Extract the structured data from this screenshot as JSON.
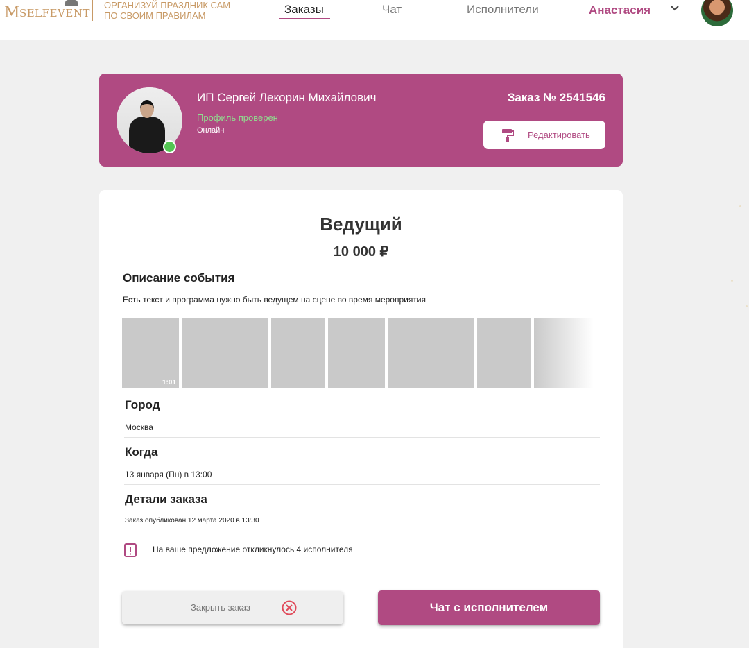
{
  "header": {
    "logo_text": "SELFEVENT",
    "tagline_line1": "ОРГАНИЗУЙ ПРАЗДНИК САМ",
    "tagline_line2": "ПО СВОИМ ПРАВИЛАМ",
    "nav": [
      {
        "label": "Заказы",
        "active": true
      },
      {
        "label": "Чат",
        "active": false
      },
      {
        "label": "Исполнители",
        "active": false
      }
    ],
    "user_name": "Анастасия"
  },
  "profile": {
    "name": "ИП Сергей Лекорин Михайлович",
    "verified": "Профиль проверен",
    "status": "Онлайн",
    "order_number": "Заказ № 2541546",
    "edit_label": "Редактировать"
  },
  "order": {
    "title": "Ведущий",
    "price": "10 000 ₽",
    "description_heading": "Описание события",
    "description": "Есть текст и программа нужно быть ведущем на сцене во время мероприятия",
    "video_duration": "1:01",
    "city_heading": "Город",
    "city": "Москва",
    "when_heading": "Когда",
    "when": "13 января (Пн) в 13:00",
    "details_heading": "Детали заказа",
    "published": "Заказ опубликован 12 марта 2020 в 13:30",
    "responses_notice": "На ваше предложение откликнулось 4 исполнителя",
    "close_label": "Закрыть заказ",
    "chat_label": "Чат с исполнителем"
  },
  "colors": {
    "accent": "#b04a82",
    "verified": "#8fe08f",
    "online": "#53c553",
    "logo": "#c89a66",
    "close_icon": "#e04a5a"
  }
}
